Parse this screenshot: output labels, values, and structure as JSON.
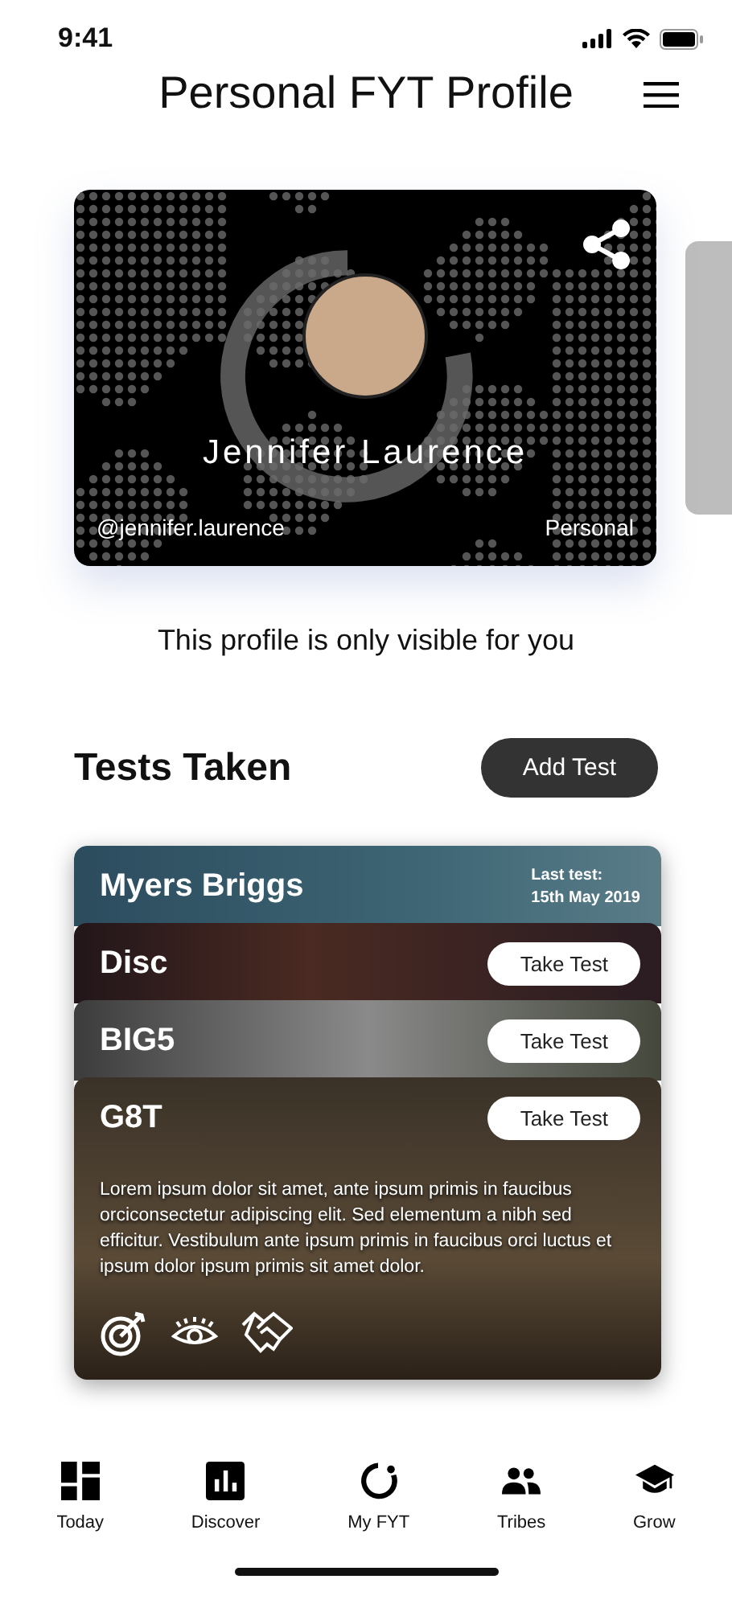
{
  "status_bar": {
    "time": "9:41"
  },
  "header": {
    "title": "Personal FYT Profile"
  },
  "profile_card": {
    "name": "Jennifer Laurence",
    "handle": "@jennifer.laurence",
    "type": "Personal"
  },
  "visibility_note": "This profile is only visible for you",
  "tests_section": {
    "title": "Tests Taken",
    "add_button": "Add Test"
  },
  "tests": [
    {
      "kind": "taken",
      "name": "Myers Briggs",
      "last_test_label": "Last test:",
      "last_test_date": "15th May 2019"
    },
    {
      "kind": "pending",
      "name": "Disc",
      "button": "Take Test"
    },
    {
      "kind": "pending",
      "name": "BIG5",
      "button": "Take Test"
    },
    {
      "kind": "expanded",
      "name": "G8T",
      "button": "Take Test",
      "description": "Lorem ipsum dolor sit amet, ante ipsum primis in faucibus orciconsectetur adipiscing elit. Sed elementum a nibh sed efficitur. Vestibulum ante ipsum primis in faucibus orci luctus et ipsum dolor ipsum primis sit amet dolor."
    }
  ],
  "tab_bar": [
    {
      "label": "Today",
      "kind": "dashboard"
    },
    {
      "label": "Discover",
      "kind": "chart"
    },
    {
      "label": "My FYT",
      "kind": "ring"
    },
    {
      "label": "Tribes",
      "kind": "people"
    },
    {
      "label": "Grow",
      "kind": "cap"
    }
  ]
}
